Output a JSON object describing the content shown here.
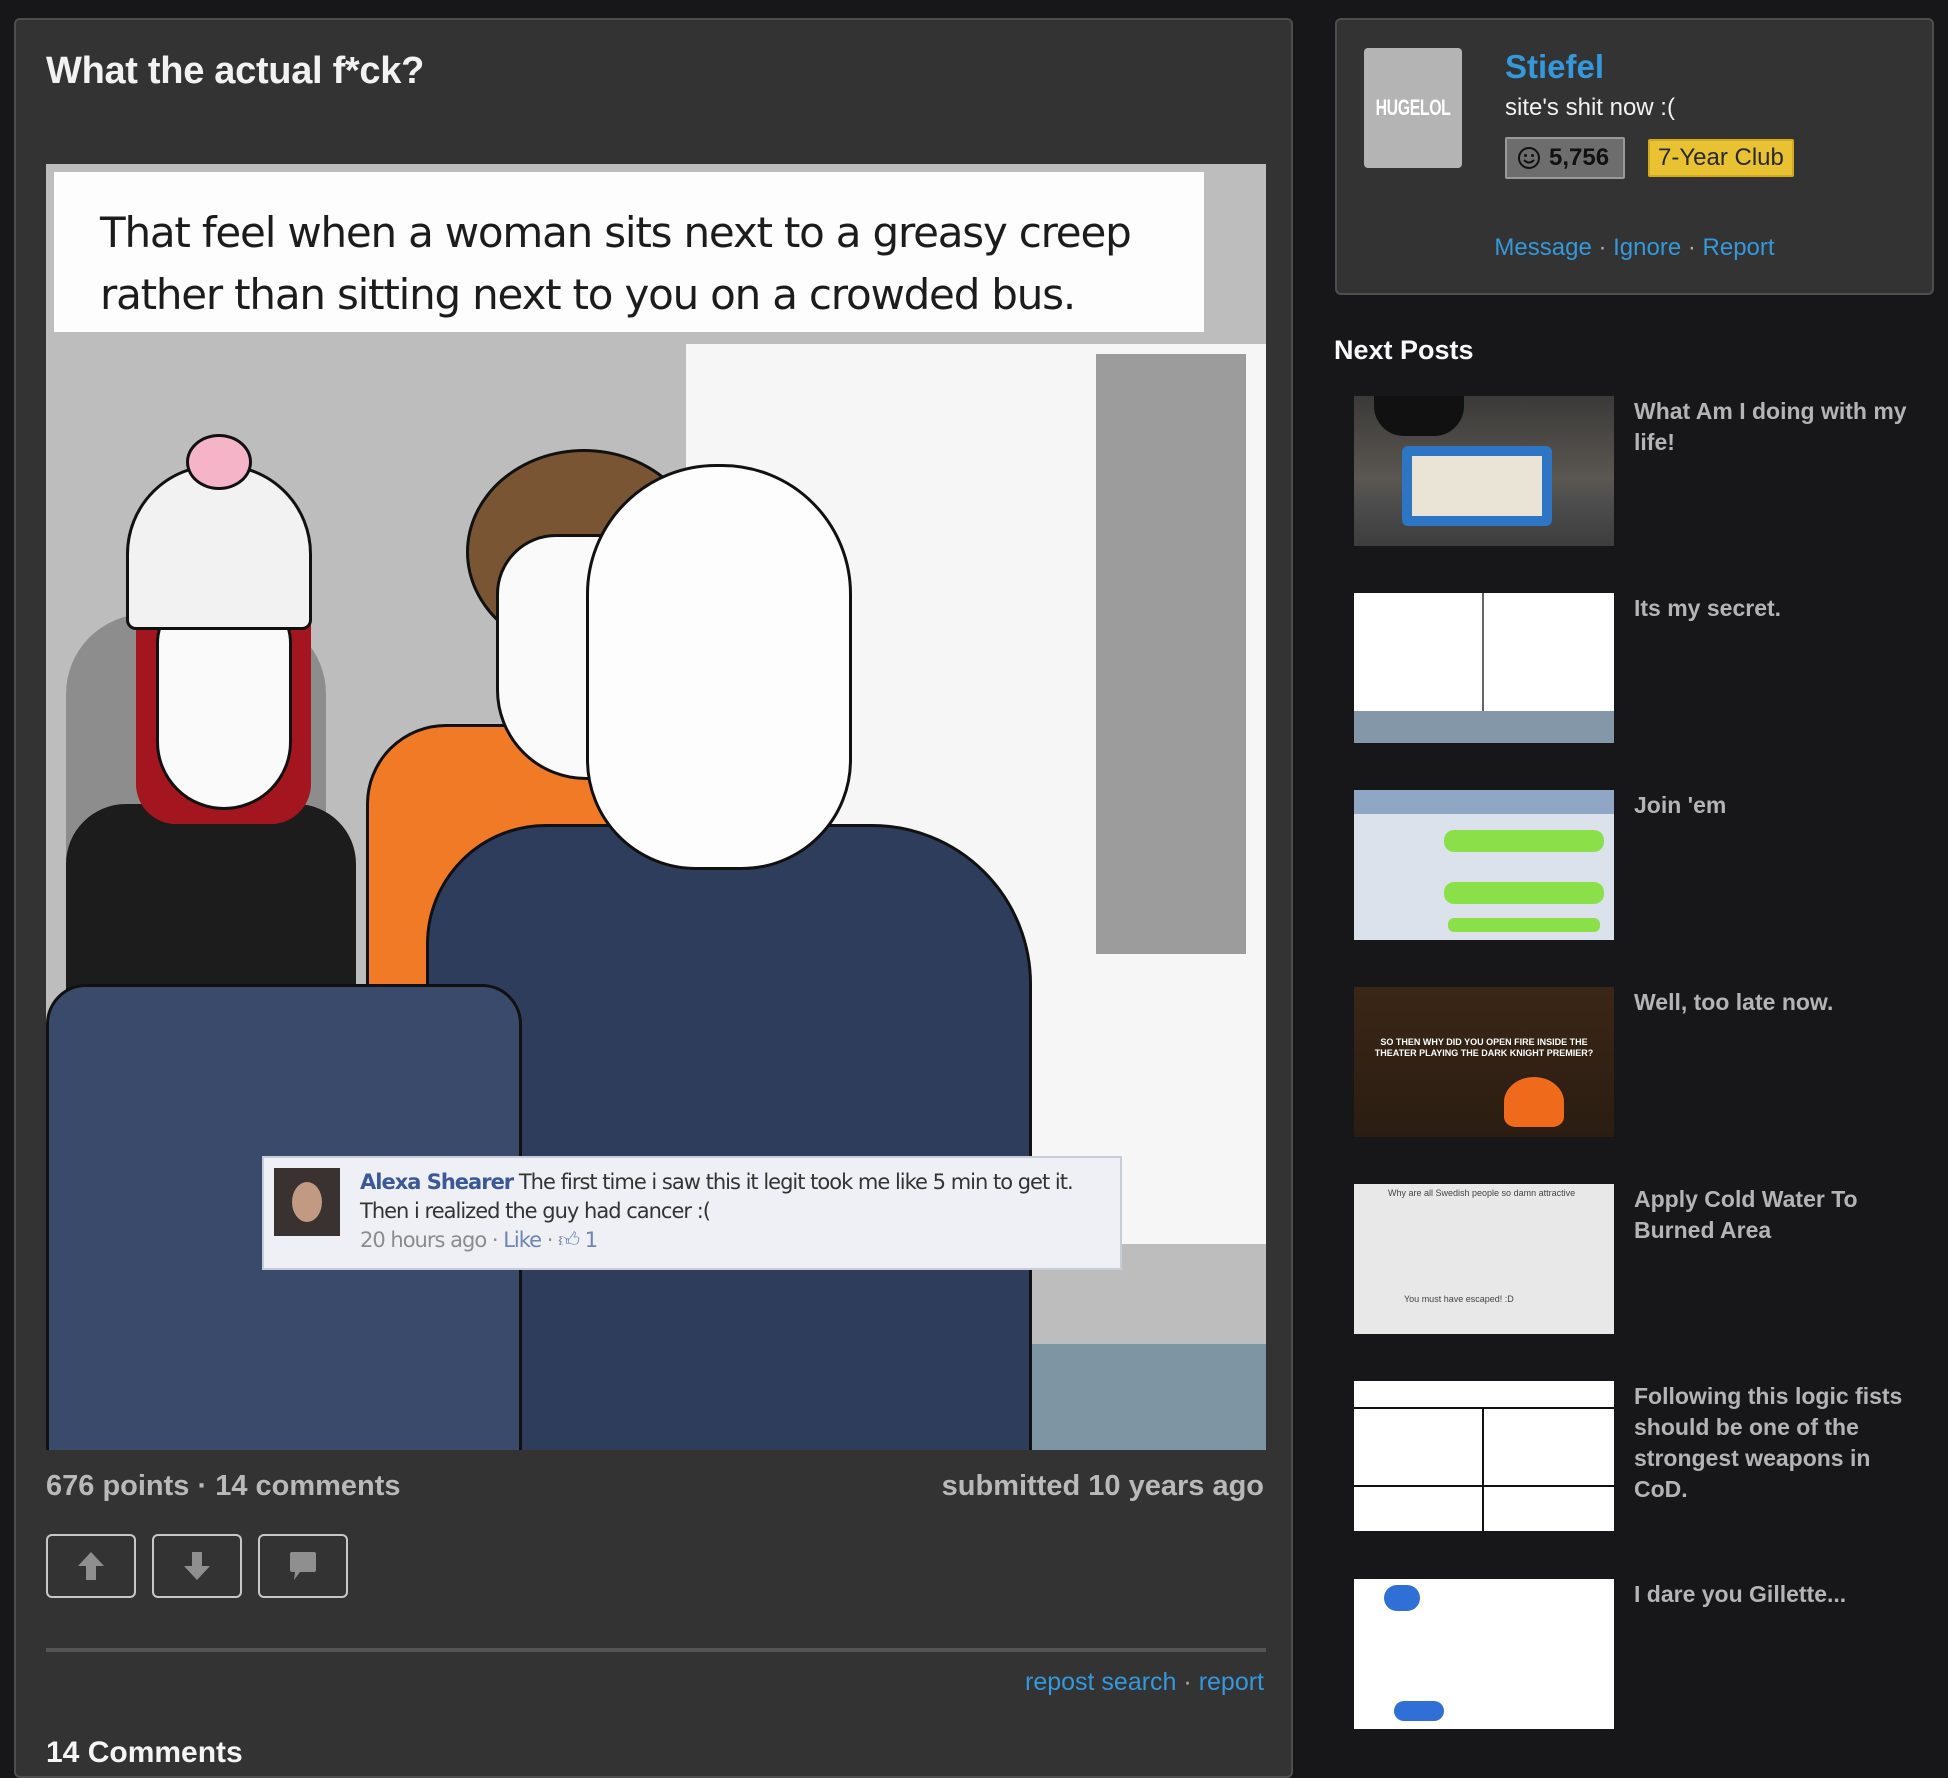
{
  "post": {
    "title": "What the actual f*ck?",
    "image": {
      "caption": "That feel when a woman sits next to a greasy creep rather than sitting next to you on a crowded bus.",
      "embedded_comment": {
        "author": "Alexa Shearer",
        "text": "The first time i saw this it legit took me like 5 min to get it. Then i realized the guy had cancer :(",
        "time": "20 hours ago",
        "separator": " · ",
        "like_label": "Like",
        "like_count": "1"
      }
    },
    "stats": "676 points · 14 comments",
    "submitted": "submitted 10 years ago",
    "actions": {
      "upvote_icon": "arrow-up-icon",
      "downvote_icon": "arrow-down-icon",
      "comment_icon": "speech-bubble-icon"
    },
    "links": {
      "repost_search": "repost search",
      "separator": " · ",
      "report": "report"
    },
    "comments_header": "14 Comments"
  },
  "user_card": {
    "avatar_text": "HUGELOL",
    "username": "Stiefel",
    "tagline": "site's shit now :(",
    "karma_icon": "smiley-icon",
    "karma": "5,756",
    "club_badge": "7-Year Club",
    "actions": {
      "message": "Message",
      "ignore": "Ignore",
      "report": "Report",
      "separator": " · "
    }
  },
  "next_posts": {
    "title": "Next Posts",
    "items": [
      {
        "title": "What Am I doing with my life!"
      },
      {
        "title": "Its my secret."
      },
      {
        "title": "Join 'em"
      },
      {
        "title": "Well, too late now."
      },
      {
        "title": "Apply Cold Water To Burned Area"
      },
      {
        "title": "Following this logic fists should be one of the strongest weapons in CoD."
      },
      {
        "title": "I dare you Gillette..."
      }
    ]
  },
  "colors": {
    "page_bg": "#17171a",
    "panel_bg": "#333333",
    "link": "#3498db",
    "badge_yellow": "#e8c232"
  }
}
